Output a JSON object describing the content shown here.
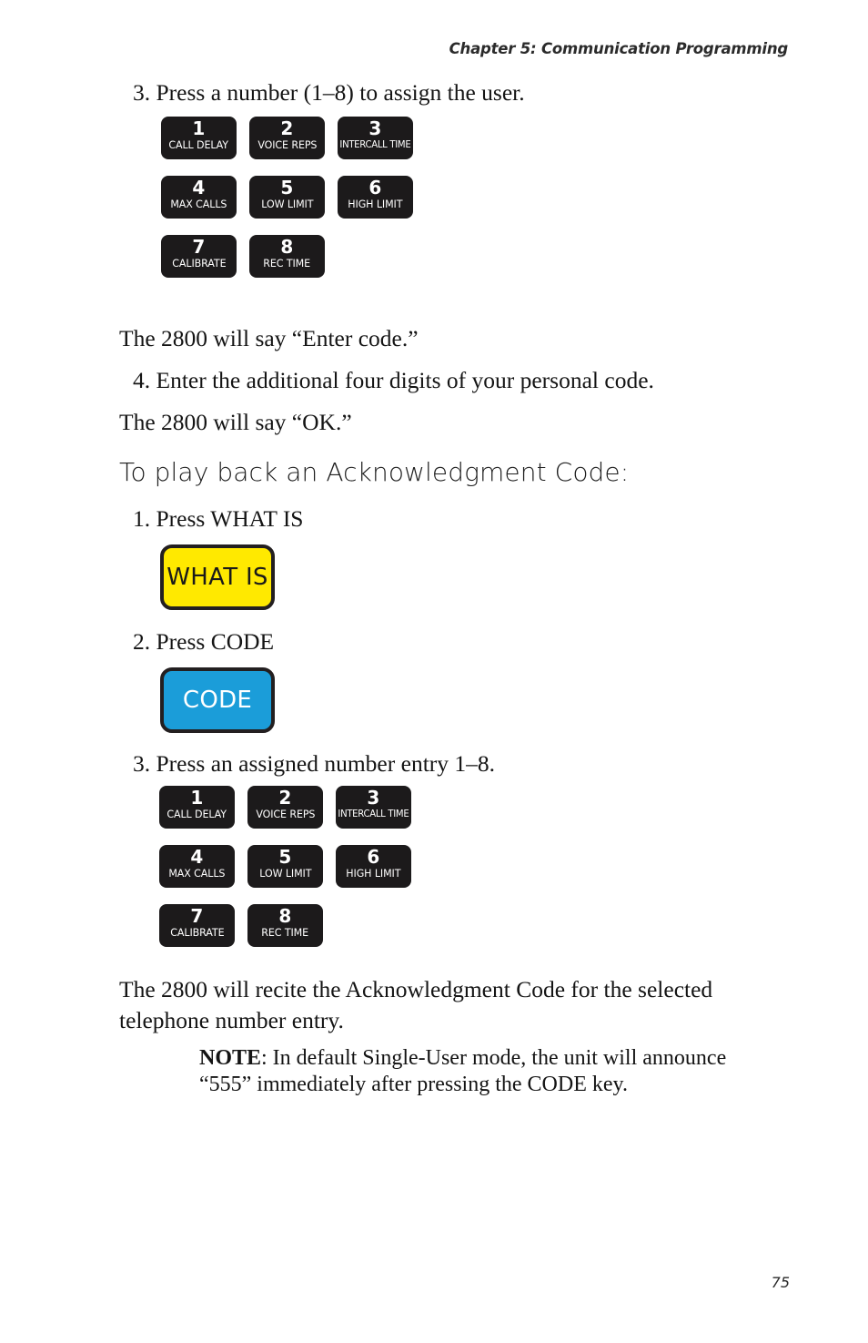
{
  "header": {
    "running_head": "Chapter 5: Communication Programming"
  },
  "steps": {
    "assign_user": "3. Press a number (1–8) to assign the user.",
    "enter_code_prompt": "The 2800 will say “Enter code.”",
    "enter_four_digits": "4. Enter the additional four digits of your personal code.",
    "ok_prompt": "The 2800 will say “OK.”",
    "press_what_is": "1. Press WHAT IS",
    "press_code": "2. Press CODE",
    "press_assigned_number": "3. Press an assigned number entry 1–8.",
    "recite_paragraph": "The 2800 will recite the Acknowledgment Code for the selected telephone number entry."
  },
  "section": {
    "heading": "To play back an Acknowledgment Code:"
  },
  "keypad": {
    "keys": [
      {
        "number": "1",
        "label": "CALL DELAY"
      },
      {
        "number": "2",
        "label": "VOICE REPS"
      },
      {
        "number": "3",
        "label": "INTERCALL TIME"
      },
      {
        "number": "4",
        "label": "MAX CALLS"
      },
      {
        "number": "5",
        "label": "LOW LIMIT"
      },
      {
        "number": "6",
        "label": "HIGH LIMIT"
      },
      {
        "number": "7",
        "label": "CALIBRATE"
      },
      {
        "number": "8",
        "label": "REC TIME"
      }
    ]
  },
  "function_keys": {
    "what_is": {
      "label": "WHAT IS",
      "background": "#ffe900",
      "text_color": "#1a1a1a",
      "border_color": "#231f20"
    },
    "code": {
      "label": "CODE",
      "background": "#1b9dd9",
      "text_color": "#ffffff",
      "border_color": "#231f20"
    }
  },
  "note": {
    "label": "NOTE",
    "body": ": In default Single-User mode, the unit will announce “555” immediately after pressing the CODE key."
  },
  "footer": {
    "page_number": "75"
  }
}
